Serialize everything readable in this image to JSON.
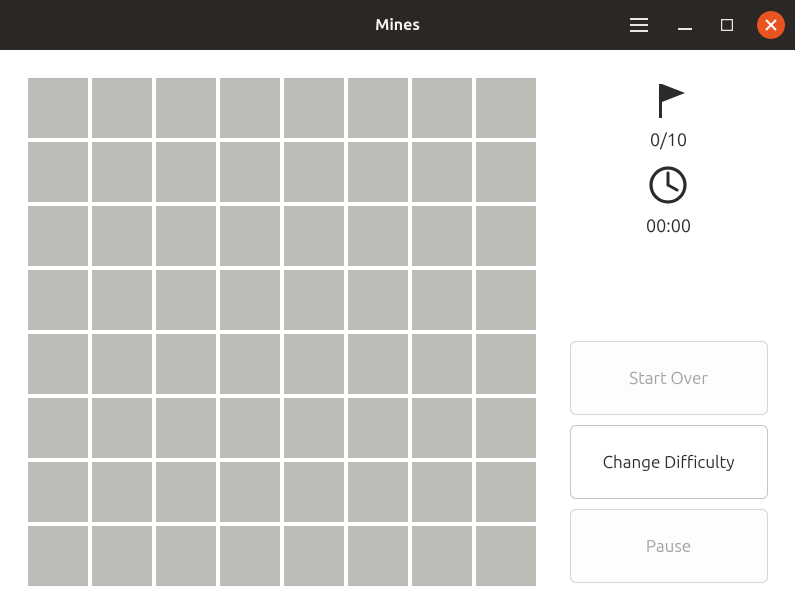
{
  "title": "Mines",
  "flags": {
    "count": "0/10"
  },
  "timer": {
    "display": "00:00"
  },
  "grid": {
    "rows": 8,
    "cols": 8
  },
  "buttons": {
    "start_over": "Start Over",
    "change_difficulty": "Change Difficulty",
    "pause": "Pause"
  }
}
